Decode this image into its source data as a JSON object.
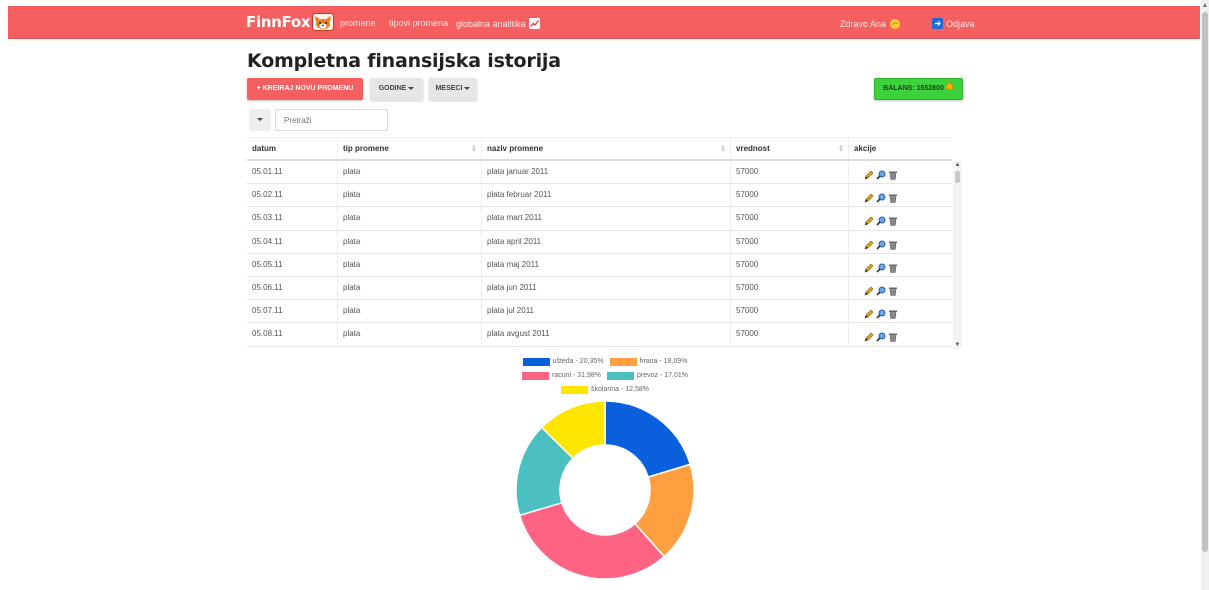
{
  "navbar": {
    "brand": "FinnFox",
    "links": [
      "promene",
      "tipovi promena",
      "globalna analitika"
    ],
    "greeting": "Zdravo Ana",
    "logout": "Odjava",
    "color": "#f55f5f"
  },
  "page": {
    "title": "Kompletna finansijska istorija"
  },
  "toolbar": {
    "create_label": "+ KREIRAJ NOVU PROMENU",
    "years_label": "GODINE",
    "months_label": "MESECI",
    "balance_label": "BALANS: 1552800"
  },
  "search": {
    "placeholder": "Pretraži"
  },
  "table": {
    "columns": [
      "datum",
      "tip promene",
      "naziv promene",
      "vrednost",
      "akcije"
    ],
    "rows": [
      [
        "05.01.11",
        "plata",
        "plata januar 2011",
        "57000"
      ],
      [
        "05.02.11",
        "plata",
        "plata februar 2011",
        "57000"
      ],
      [
        "05.03.11",
        "plata",
        "plata mart 2011",
        "57000"
      ],
      [
        "05.04.11",
        "plata",
        "plata april 2011",
        "57000"
      ],
      [
        "05.05.11",
        "plata",
        "plata maj 2011",
        "57000"
      ],
      [
        "05.06.11",
        "plata",
        "plata jun 2011",
        "57000"
      ],
      [
        "05.07.11",
        "plata",
        "plata jul 2011",
        "57000"
      ],
      [
        "05.08.11",
        "plata",
        "plata avgust 2011",
        "57000"
      ]
    ],
    "action_icons": [
      "pencil-icon",
      "magnifier-icon",
      "trash-icon"
    ]
  },
  "chart_data": {
    "type": "pie",
    "donut": true,
    "legend_position": "top",
    "slices": [
      {
        "label": "ušteda - 20,35%",
        "value": 20.35,
        "color": "#0a5fdc"
      },
      {
        "label": "hrana - 18,09%",
        "value": 18.09,
        "color": "#ff9f40"
      },
      {
        "label": "racuni - 31,98%",
        "value": 31.98,
        "color": "#ff6384"
      },
      {
        "label": "prevoz - 17,01%",
        "value": 17.01,
        "color": "#4bc0c0"
      },
      {
        "label": "školarina - 12,58%",
        "value": 12.58,
        "color": "#ffe600"
      }
    ]
  }
}
